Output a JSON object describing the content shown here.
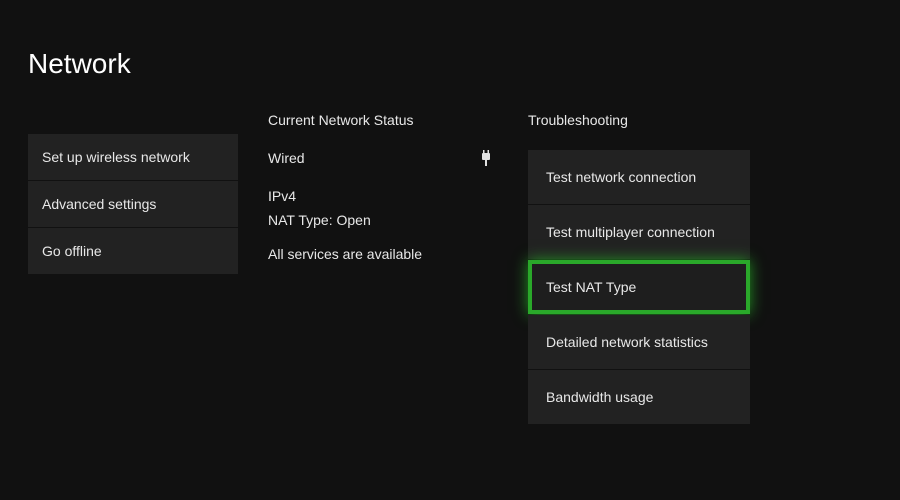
{
  "page_title": "Network",
  "left_menu": {
    "items": [
      {
        "label": "Set up wireless network",
        "name": "setup-wireless-button"
      },
      {
        "label": "Advanced settings",
        "name": "advanced-settings-button"
      },
      {
        "label": "Go offline",
        "name": "go-offline-button"
      }
    ]
  },
  "status": {
    "header": "Current Network Status",
    "connection_type": "Wired",
    "ip_version": "IPv4",
    "nat_label": "NAT Type: Open",
    "services_status": "All services are available"
  },
  "troubleshooting": {
    "header": "Troubleshooting",
    "items": [
      {
        "label": "Test network connection",
        "name": "test-network-connection-button",
        "highlighted": false
      },
      {
        "label": "Test multiplayer connection",
        "name": "test-multiplayer-connection-button",
        "highlighted": false
      },
      {
        "label": "Test NAT Type",
        "name": "test-nat-type-button",
        "highlighted": true
      },
      {
        "label": "Detailed network statistics",
        "name": "detailed-network-statistics-button",
        "highlighted": false
      },
      {
        "label": "Bandwidth usage",
        "name": "bandwidth-usage-button",
        "highlighted": false
      }
    ]
  }
}
